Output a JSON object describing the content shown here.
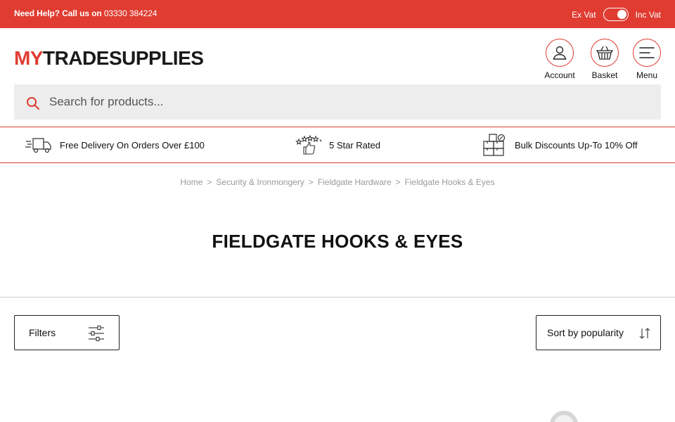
{
  "topbar": {
    "help_prefix": "Need Help? Call us on",
    "phone": "03330 384224",
    "vat_ex": "Ex Vat",
    "vat_inc": "Inc Vat",
    "vat_state": "inc"
  },
  "header": {
    "logo_my": "MY",
    "logo_rest": "TRADESUPPLIES",
    "account_label": "Account",
    "basket_label": "Basket",
    "menu_label": "Menu"
  },
  "search": {
    "placeholder": "Search for products..."
  },
  "usp": {
    "delivery": "Free Delivery On Orders Over £100",
    "rating": "5 Star Rated",
    "bulk": "Bulk Discounts Up-To 10% Off"
  },
  "breadcrumb": [
    "Home",
    "Security & Ironmongery",
    "Fieldgate Hardware",
    "Fieldgate Hooks & Eyes"
  ],
  "breadcrumb_separator": ">",
  "page_title": "FIELDGATE HOOKS & EYES",
  "controls": {
    "filters_label": "Filters",
    "sort_label": "Sort by popularity"
  },
  "colors": {
    "brand": "#e03c31",
    "search_bg": "#ededed",
    "text": "#111111"
  }
}
